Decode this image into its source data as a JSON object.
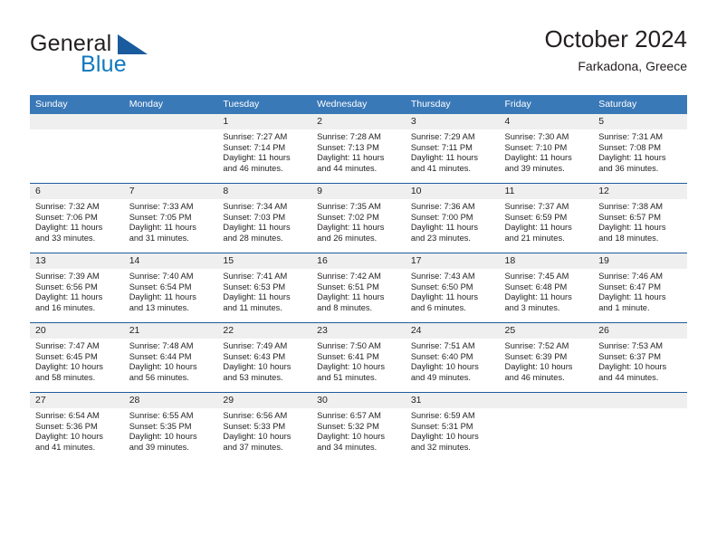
{
  "brand": {
    "name_part1": "General",
    "name_part2": "Blue",
    "logo_icon": "triangle-flag-icon"
  },
  "header": {
    "title": "October 2024",
    "location": "Farkadona, Greece"
  },
  "calendar": {
    "weekday_headers": [
      "Sunday",
      "Monday",
      "Tuesday",
      "Wednesday",
      "Thursday",
      "Friday",
      "Saturday"
    ],
    "accent_header_color": "#3a79b8",
    "row_divider_color": "#1e5c9e",
    "daynum_band_color": "#efefef",
    "weeks": [
      [
        {
          "day": "",
          "blank": true,
          "sunrise": "",
          "sunset": "",
          "daylight1": "",
          "daylight2": ""
        },
        {
          "day": "",
          "blank": true,
          "sunrise": "",
          "sunset": "",
          "daylight1": "",
          "daylight2": ""
        },
        {
          "day": "1",
          "blank": false,
          "sunrise": "Sunrise: 7:27 AM",
          "sunset": "Sunset: 7:14 PM",
          "daylight1": "Daylight: 11 hours",
          "daylight2": "and 46 minutes."
        },
        {
          "day": "2",
          "blank": false,
          "sunrise": "Sunrise: 7:28 AM",
          "sunset": "Sunset: 7:13 PM",
          "daylight1": "Daylight: 11 hours",
          "daylight2": "and 44 minutes."
        },
        {
          "day": "3",
          "blank": false,
          "sunrise": "Sunrise: 7:29 AM",
          "sunset": "Sunset: 7:11 PM",
          "daylight1": "Daylight: 11 hours",
          "daylight2": "and 41 minutes."
        },
        {
          "day": "4",
          "blank": false,
          "sunrise": "Sunrise: 7:30 AM",
          "sunset": "Sunset: 7:10 PM",
          "daylight1": "Daylight: 11 hours",
          "daylight2": "and 39 minutes."
        },
        {
          "day": "5",
          "blank": false,
          "sunrise": "Sunrise: 7:31 AM",
          "sunset": "Sunset: 7:08 PM",
          "daylight1": "Daylight: 11 hours",
          "daylight2": "and 36 minutes."
        }
      ],
      [
        {
          "day": "6",
          "blank": false,
          "sunrise": "Sunrise: 7:32 AM",
          "sunset": "Sunset: 7:06 PM",
          "daylight1": "Daylight: 11 hours",
          "daylight2": "and 33 minutes."
        },
        {
          "day": "7",
          "blank": false,
          "sunrise": "Sunrise: 7:33 AM",
          "sunset": "Sunset: 7:05 PM",
          "daylight1": "Daylight: 11 hours",
          "daylight2": "and 31 minutes."
        },
        {
          "day": "8",
          "blank": false,
          "sunrise": "Sunrise: 7:34 AM",
          "sunset": "Sunset: 7:03 PM",
          "daylight1": "Daylight: 11 hours",
          "daylight2": "and 28 minutes."
        },
        {
          "day": "9",
          "blank": false,
          "sunrise": "Sunrise: 7:35 AM",
          "sunset": "Sunset: 7:02 PM",
          "daylight1": "Daylight: 11 hours",
          "daylight2": "and 26 minutes."
        },
        {
          "day": "10",
          "blank": false,
          "sunrise": "Sunrise: 7:36 AM",
          "sunset": "Sunset: 7:00 PM",
          "daylight1": "Daylight: 11 hours",
          "daylight2": "and 23 minutes."
        },
        {
          "day": "11",
          "blank": false,
          "sunrise": "Sunrise: 7:37 AM",
          "sunset": "Sunset: 6:59 PM",
          "daylight1": "Daylight: 11 hours",
          "daylight2": "and 21 minutes."
        },
        {
          "day": "12",
          "blank": false,
          "sunrise": "Sunrise: 7:38 AM",
          "sunset": "Sunset: 6:57 PM",
          "daylight1": "Daylight: 11 hours",
          "daylight2": "and 18 minutes."
        }
      ],
      [
        {
          "day": "13",
          "blank": false,
          "sunrise": "Sunrise: 7:39 AM",
          "sunset": "Sunset: 6:56 PM",
          "daylight1": "Daylight: 11 hours",
          "daylight2": "and 16 minutes."
        },
        {
          "day": "14",
          "blank": false,
          "sunrise": "Sunrise: 7:40 AM",
          "sunset": "Sunset: 6:54 PM",
          "daylight1": "Daylight: 11 hours",
          "daylight2": "and 13 minutes."
        },
        {
          "day": "15",
          "blank": false,
          "sunrise": "Sunrise: 7:41 AM",
          "sunset": "Sunset: 6:53 PM",
          "daylight1": "Daylight: 11 hours",
          "daylight2": "and 11 minutes."
        },
        {
          "day": "16",
          "blank": false,
          "sunrise": "Sunrise: 7:42 AM",
          "sunset": "Sunset: 6:51 PM",
          "daylight1": "Daylight: 11 hours",
          "daylight2": "and 8 minutes."
        },
        {
          "day": "17",
          "blank": false,
          "sunrise": "Sunrise: 7:43 AM",
          "sunset": "Sunset: 6:50 PM",
          "daylight1": "Daylight: 11 hours",
          "daylight2": "and 6 minutes."
        },
        {
          "day": "18",
          "blank": false,
          "sunrise": "Sunrise: 7:45 AM",
          "sunset": "Sunset: 6:48 PM",
          "daylight1": "Daylight: 11 hours",
          "daylight2": "and 3 minutes."
        },
        {
          "day": "19",
          "blank": false,
          "sunrise": "Sunrise: 7:46 AM",
          "sunset": "Sunset: 6:47 PM",
          "daylight1": "Daylight: 11 hours",
          "daylight2": "and 1 minute."
        }
      ],
      [
        {
          "day": "20",
          "blank": false,
          "sunrise": "Sunrise: 7:47 AM",
          "sunset": "Sunset: 6:45 PM",
          "daylight1": "Daylight: 10 hours",
          "daylight2": "and 58 minutes."
        },
        {
          "day": "21",
          "blank": false,
          "sunrise": "Sunrise: 7:48 AM",
          "sunset": "Sunset: 6:44 PM",
          "daylight1": "Daylight: 10 hours",
          "daylight2": "and 56 minutes."
        },
        {
          "day": "22",
          "blank": false,
          "sunrise": "Sunrise: 7:49 AM",
          "sunset": "Sunset: 6:43 PM",
          "daylight1": "Daylight: 10 hours",
          "daylight2": "and 53 minutes."
        },
        {
          "day": "23",
          "blank": false,
          "sunrise": "Sunrise: 7:50 AM",
          "sunset": "Sunset: 6:41 PM",
          "daylight1": "Daylight: 10 hours",
          "daylight2": "and 51 minutes."
        },
        {
          "day": "24",
          "blank": false,
          "sunrise": "Sunrise: 7:51 AM",
          "sunset": "Sunset: 6:40 PM",
          "daylight1": "Daylight: 10 hours",
          "daylight2": "and 49 minutes."
        },
        {
          "day": "25",
          "blank": false,
          "sunrise": "Sunrise: 7:52 AM",
          "sunset": "Sunset: 6:39 PM",
          "daylight1": "Daylight: 10 hours",
          "daylight2": "and 46 minutes."
        },
        {
          "day": "26",
          "blank": false,
          "sunrise": "Sunrise: 7:53 AM",
          "sunset": "Sunset: 6:37 PM",
          "daylight1": "Daylight: 10 hours",
          "daylight2": "and 44 minutes."
        }
      ],
      [
        {
          "day": "27",
          "blank": false,
          "sunrise": "Sunrise: 6:54 AM",
          "sunset": "Sunset: 5:36 PM",
          "daylight1": "Daylight: 10 hours",
          "daylight2": "and 41 minutes."
        },
        {
          "day": "28",
          "blank": false,
          "sunrise": "Sunrise: 6:55 AM",
          "sunset": "Sunset: 5:35 PM",
          "daylight1": "Daylight: 10 hours",
          "daylight2": "and 39 minutes."
        },
        {
          "day": "29",
          "blank": false,
          "sunrise": "Sunrise: 6:56 AM",
          "sunset": "Sunset: 5:33 PM",
          "daylight1": "Daylight: 10 hours",
          "daylight2": "and 37 minutes."
        },
        {
          "day": "30",
          "blank": false,
          "sunrise": "Sunrise: 6:57 AM",
          "sunset": "Sunset: 5:32 PM",
          "daylight1": "Daylight: 10 hours",
          "daylight2": "and 34 minutes."
        },
        {
          "day": "31",
          "blank": false,
          "sunrise": "Sunrise: 6:59 AM",
          "sunset": "Sunset: 5:31 PM",
          "daylight1": "Daylight: 10 hours",
          "daylight2": "and 32 minutes."
        },
        {
          "day": "",
          "blank": true,
          "sunrise": "",
          "sunset": "",
          "daylight1": "",
          "daylight2": ""
        },
        {
          "day": "",
          "blank": true,
          "sunrise": "",
          "sunset": "",
          "daylight1": "",
          "daylight2": ""
        }
      ]
    ]
  }
}
